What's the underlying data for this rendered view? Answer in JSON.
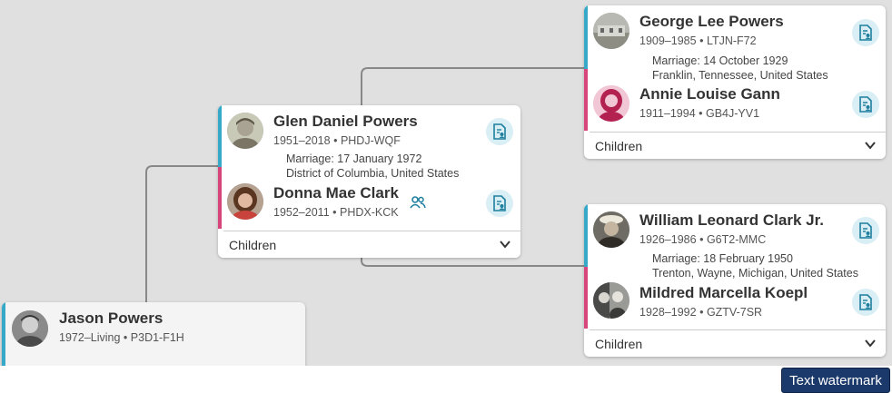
{
  "focus": {
    "name": "Jason Powers",
    "years": "1972–Living",
    "id": "P3D1-F1H"
  },
  "parents": {
    "father": {
      "name": "Glen Daniel Powers",
      "years": "1951–2018",
      "id": "PHDJ-WQF"
    },
    "marriage_line1": "Marriage: 17 January 1972",
    "marriage_line2": "District of Columbia, United States",
    "mother": {
      "name": "Donna Mae Clark",
      "years": "1952–2011",
      "id": "PHDX-KCK"
    },
    "children_label": "Children"
  },
  "paternal": {
    "father": {
      "name": "George Lee Powers",
      "years": "1909–1985",
      "id": "LTJN-F72"
    },
    "marriage_line1": "Marriage: 14 October 1929",
    "marriage_line2": "Franklin, Tennessee, United States",
    "mother": {
      "name": "Annie Louise Gann",
      "years": "1911–1994",
      "id": "GB4J-YV1"
    },
    "children_label": "Children"
  },
  "maternal": {
    "father": {
      "name": "William Leonard Clark Jr.",
      "years": "1926–1986",
      "id": "G6T2-MMC"
    },
    "marriage_line1": "Marriage: 18 February 1950",
    "marriage_line2": "Trenton, Wayne, Michigan, United States",
    "mother": {
      "name": "Mildred Marcella Koepl",
      "years": "1928–1992",
      "id": "GZTV-7SR"
    },
    "children_label": "Children"
  },
  "separator": "•",
  "watermark": "Text watermark",
  "colors": {
    "male": "#36a8c8",
    "female": "#d8457a",
    "icon": "#1f7f9f",
    "background": "#dfe0df"
  },
  "icons": [
    "record-hints-icon",
    "chevron-down-icon",
    "people-icon"
  ]
}
